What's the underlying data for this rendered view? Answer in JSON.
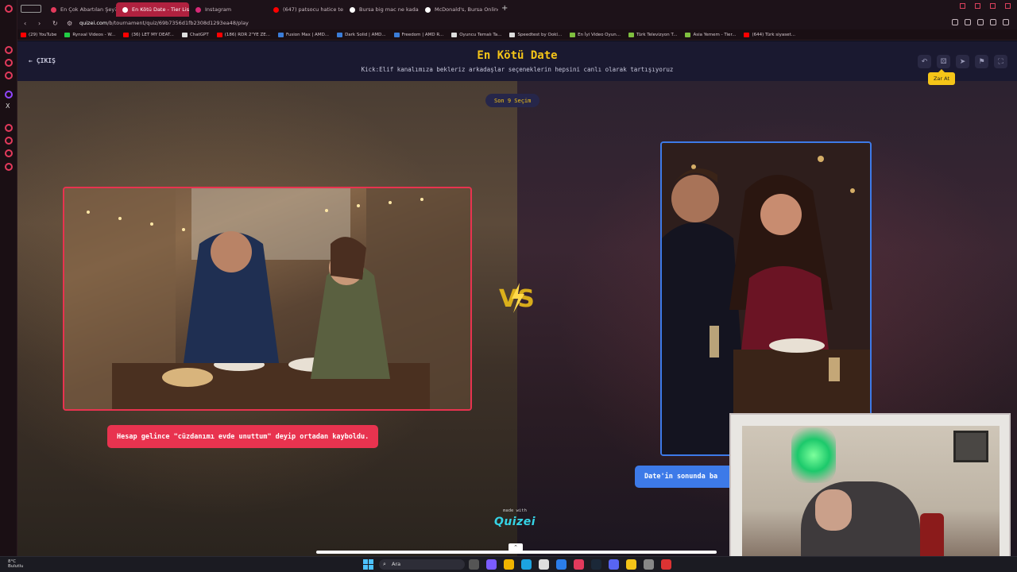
{
  "browser": {
    "tabs": [
      {
        "label": "En Çok Abartılan Şey? #1",
        "color": "#e33a5c",
        "active": false
      },
      {
        "label": "En Kötü Date - Tier List, ×",
        "color": "#ffffff",
        "active": true
      },
      {
        "label": "Instagram",
        "color": "#d62976",
        "active": false
      },
      {
        "label": "(647) patsocu hatice teyz",
        "color": "#ff0000",
        "active": false
      },
      {
        "label": "Bursa big mac ne kadar",
        "color": "#ffffff",
        "active": false
      },
      {
        "label": "McDonald's, Bursa Online",
        "color": "#ffffff",
        "active": false
      }
    ],
    "url_host": "quizei.com",
    "url_path": "/b/tournament/quiz/69b7356d1fb2308d1293ea48/play",
    "bookmarks": [
      {
        "label": "(29) YouTube",
        "color": "#ff0000"
      },
      {
        "label": "Rynxal Videos - W...",
        "color": "#22cc44"
      },
      {
        "label": "(36) LET MY DEAT...",
        "color": "#ff0000"
      },
      {
        "label": "ChatGPT",
        "color": "#dddddd"
      },
      {
        "label": "(186) RDR 2\"YE ZE...",
        "color": "#ff0000"
      },
      {
        "label": "Fusion Max | AMD...",
        "color": "#3b7dd8"
      },
      {
        "label": "Dark Solid | AMD...",
        "color": "#3b7dd8"
      },
      {
        "label": "Freedom | AMD R...",
        "color": "#3b7dd8"
      },
      {
        "label": "Oyuncu Temalı Ta...",
        "color": "#dddddd"
      },
      {
        "label": "Speedtest by Ookl...",
        "color": "#dddddd"
      },
      {
        "label": "En İyi Video Oyun...",
        "color": "#7fbf3f"
      },
      {
        "label": "Türk Televizyon T...",
        "color": "#7fbf3f"
      },
      {
        "label": "Asia Yemem - Tier...",
        "color": "#7fbf3f"
      },
      {
        "label": "(644) Türk siyaset...",
        "color": "#ff0000"
      }
    ]
  },
  "quiz": {
    "exit_label": "ÇIKIŞ",
    "title": "En Kötü Date",
    "subtitle": "Kick:Elif kanalımıza bekleriz arkadaşlar seçeneklerin hepsini canlı olarak tartışıyoruz",
    "round_label": "Son 9 Seçim",
    "tooltip": "Zar At",
    "left_caption": "Hesap gelince \"cüzdanımı evde unuttum\" deyip ortadan kayboldu.",
    "right_caption": "Date'in sonunda ba",
    "made_with": "made with",
    "logo": "Quizei",
    "accent_left": "#e8334f",
    "accent_right": "#3d7ae8",
    "accent_yellow": "#f5c518"
  },
  "taskbar": {
    "temp": "8°C",
    "weather": "Bulutlu",
    "search_label": "Ara"
  }
}
